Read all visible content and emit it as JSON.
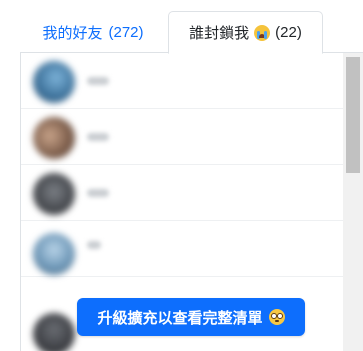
{
  "tabs": {
    "friends": {
      "label": "我的好友",
      "count": "(272)"
    },
    "blockers": {
      "label": "誰封鎖我",
      "icon": "crying-face-icon",
      "count": "(22)"
    }
  },
  "upgrade_button": {
    "label": "升級擴充以查看完整清單",
    "icon": "flushed-face-icon"
  },
  "colors": {
    "accent": "#0d6efd",
    "border": "#dee2e6",
    "scrollbar_thumb": "#c1c1c1"
  },
  "list": {
    "rows": [
      {
        "avatar_color": "#4a90c2"
      },
      {
        "avatar_color": "#8a6a55"
      },
      {
        "avatar_color": "#4b4f55"
      },
      {
        "avatar_color": "#6f98b8"
      },
      {
        "avatar_color": "#3d3f44"
      }
    ]
  }
}
